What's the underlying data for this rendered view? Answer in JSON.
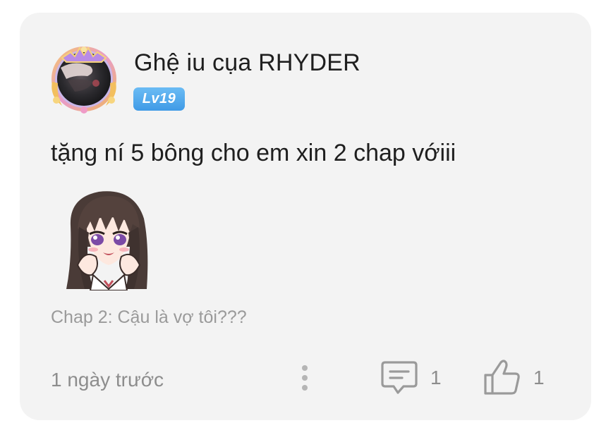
{
  "comment": {
    "username": "Ghệ iu cụa RHYDER",
    "level": "Lv19",
    "text": "tặng ní 5 bông cho em xin 2 chap vớiii",
    "chapter_ref": "Chap 2: Cậu là vợ tôi???",
    "timestamp": "1 ngày trước",
    "comment_count": "1",
    "like_count": "1"
  },
  "icons": {
    "avatar": "avatar-with-crown-frame",
    "sticker": "anime-girl-sticker",
    "more": "more-vertical-icon",
    "reply": "comment-bubble-icon",
    "like": "thumbs-up-icon"
  },
  "colors": {
    "card_bg": "#f3f3f3",
    "level_badge": "#4aa3ea",
    "muted_text": "#8d8d8d"
  }
}
